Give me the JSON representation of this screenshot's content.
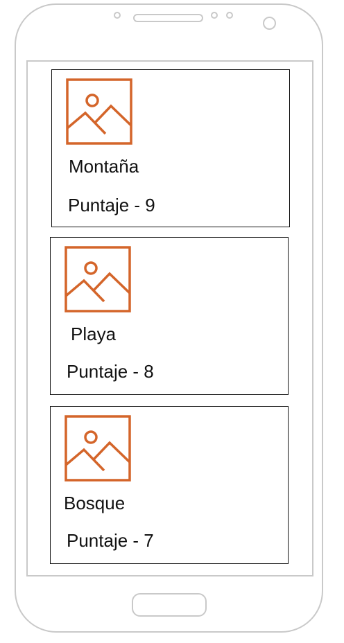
{
  "accent_color": "#D4652A",
  "cards": [
    {
      "title": "Montaña",
      "score_label": "Puntaje - 9",
      "icon": "image-placeholder-icon"
    },
    {
      "title": "Playa",
      "score_label": "Puntaje - 8",
      "icon": "image-placeholder-icon"
    },
    {
      "title": "Bosque",
      "score_label": "Puntaje - 7",
      "icon": "image-placeholder-icon"
    }
  ]
}
